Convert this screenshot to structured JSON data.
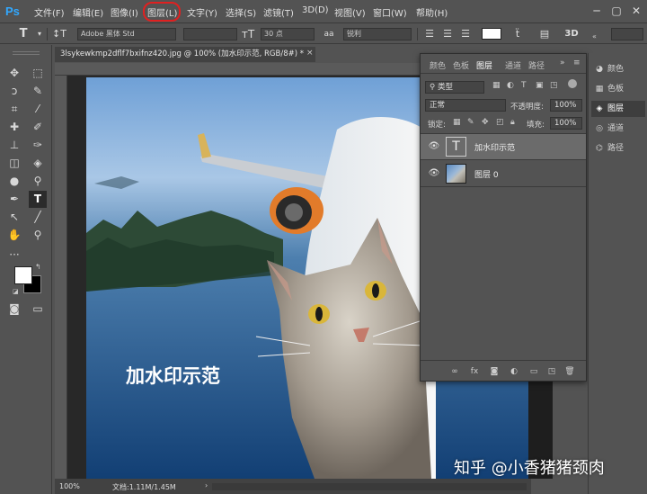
{
  "app": {
    "logo": "Ps"
  },
  "menu": {
    "items": [
      "文件(F)",
      "编辑(E)",
      "图像(I)",
      "图层(L)",
      "文字(Y)",
      "选择(S)",
      "滤镜(T)",
      "3D(D)",
      "视图(V)",
      "窗口(W)",
      "帮助(H)"
    ],
    "highlighted": "图层(L)",
    "highlight_color": "#e02020"
  },
  "options_bar": {
    "font_family": "Adobe 黑体 Std",
    "font_size": "30 点",
    "antialias_label": "aa",
    "antialias": "锐利",
    "text_color": "#ffffff"
  },
  "document": {
    "tab_title": "3lsykewkmp2dflf7bxifnz420.jpg @ 100% (加水印示范, RGB/8#) *",
    "zoom": "100%",
    "doc_size": "文档:1.11M/1.45M",
    "watermark_text": "加水印示范"
  },
  "layers_panel": {
    "tabs": [
      "颜色",
      "色板",
      "图层",
      "通道",
      "路径"
    ],
    "active_tab": "图层",
    "filter_label": "类型",
    "blend_mode": "正常",
    "opacity_label": "不透明度:",
    "opacity_value": "100%",
    "lock_label": "锁定:",
    "fill_label": "填充:",
    "fill_value": "100%",
    "layers": [
      {
        "name": "加水印示范",
        "type": "text",
        "thumb_glyph": "T",
        "selected": true
      },
      {
        "name": "图层 0",
        "type": "image",
        "selected": false
      }
    ]
  },
  "right_panel": {
    "items": [
      "颜色",
      "色板",
      "图层",
      "通道",
      "路径"
    ],
    "active": "图层"
  },
  "overlay": {
    "watermark": "知乎 @小香猪猪颈肉"
  },
  "colors": {
    "ui_bg": "#535353",
    "ui_dark": "#424242",
    "accent_ps": "#31a8ff",
    "selected_row": "#6b6b6b"
  }
}
